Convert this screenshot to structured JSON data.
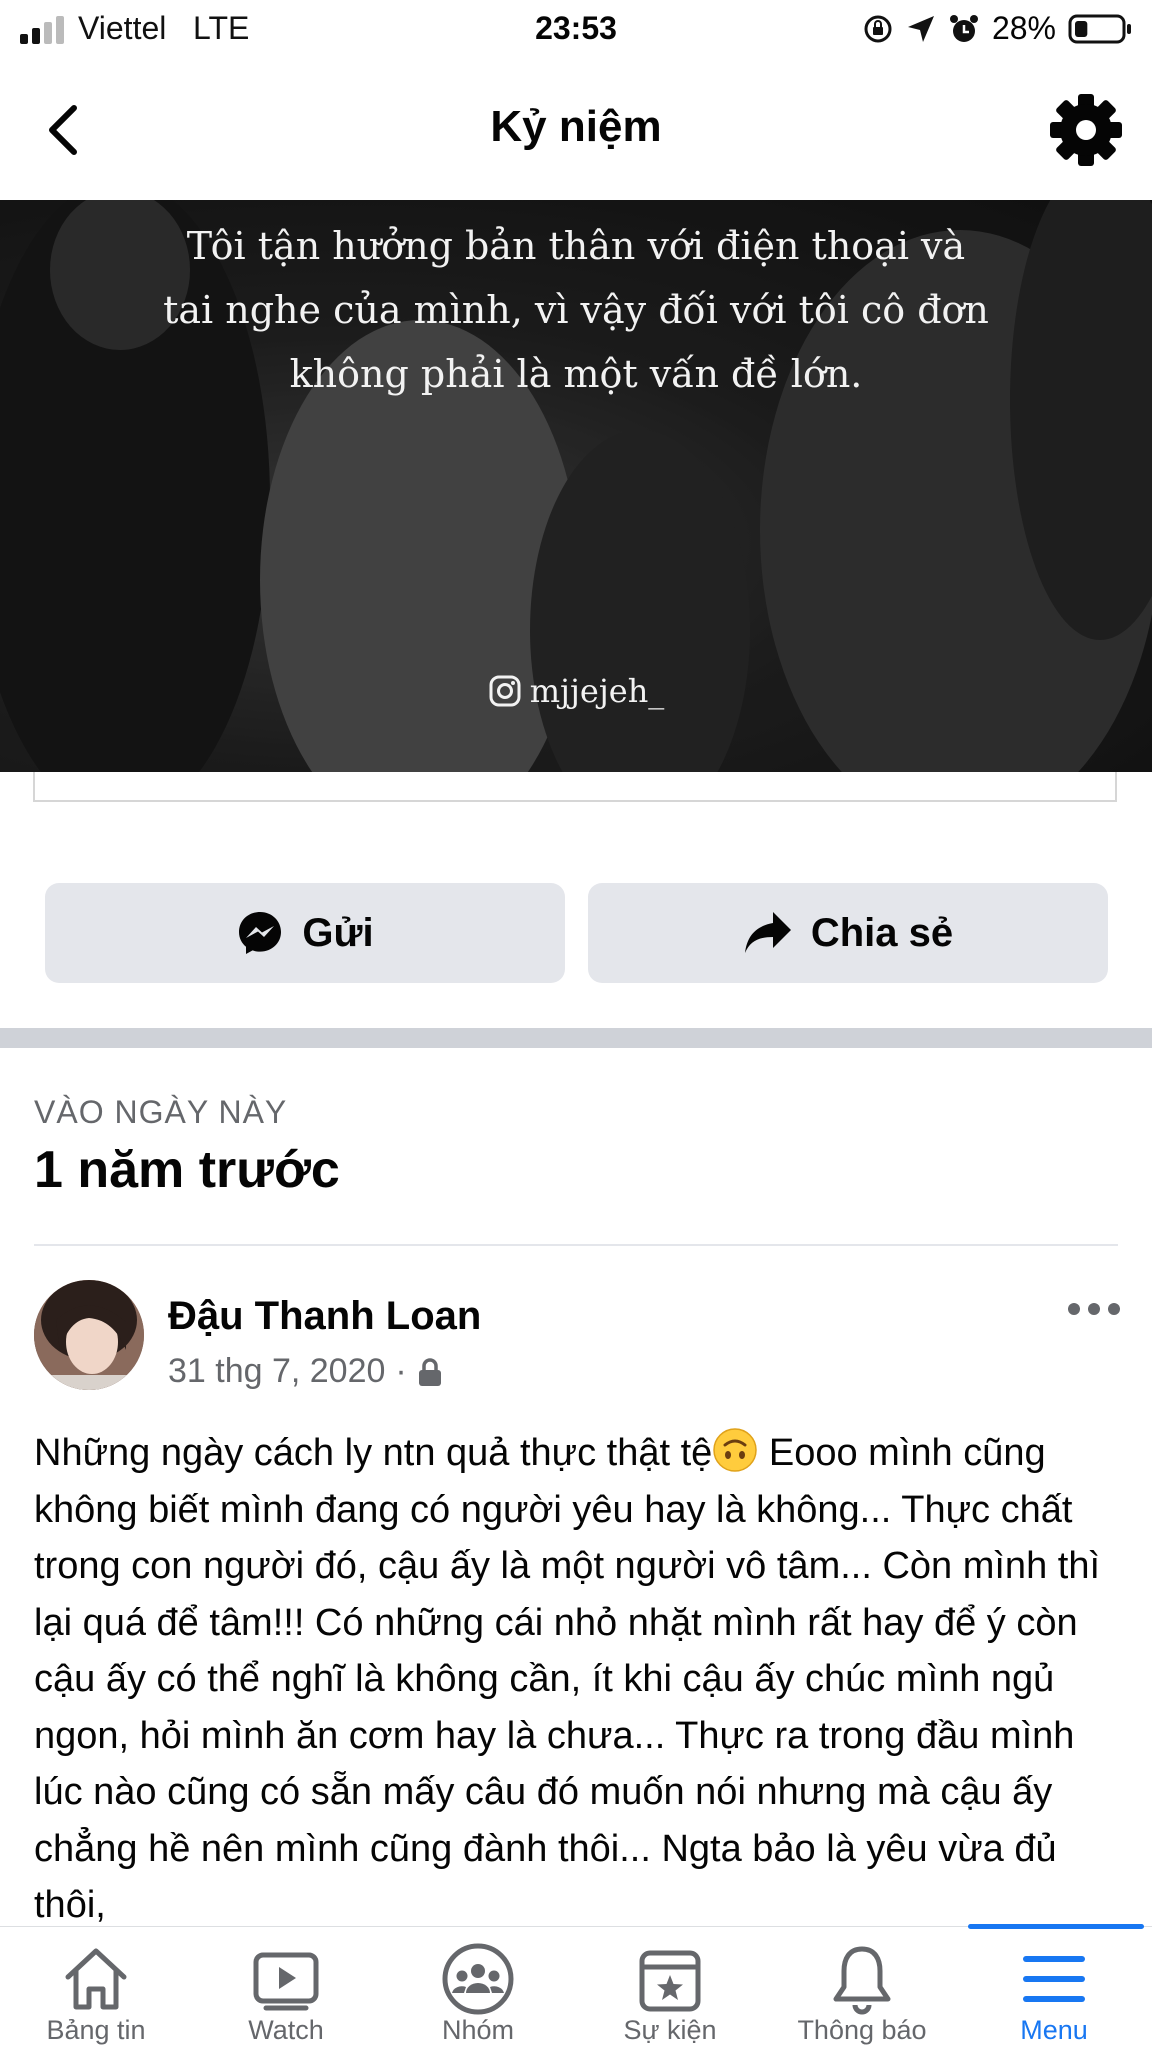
{
  "status_bar": {
    "carrier": "Viettel",
    "network": "LTE",
    "time": "23:53",
    "battery": "28%",
    "battery_level": 0.28
  },
  "header": {
    "title": "Kỷ niệm",
    "back_icon": "chevron-left-icon",
    "settings_icon": "gear-icon"
  },
  "memory": {
    "quote_lines": [
      "Tôi tận hưởng bản thân với điện thoại và",
      "tai nghe của mình, vì vậy đối với tôi cô đơn",
      "không phải là một vấn đề lớn."
    ],
    "instagram_handle": "mjjejeh_"
  },
  "actions": {
    "send_label": "Gửi",
    "share_label": "Chia sẻ"
  },
  "on_this_day": {
    "label": "VÀO NGÀY NÀY",
    "title": "1 năm trước"
  },
  "post": {
    "author": "Đậu Thanh Loan",
    "date": "31 thg 7, 2020",
    "separator": "·",
    "privacy_icon": "lock-icon",
    "body_before_emoji": "Những ngày cách ly ntn quả thực thật tệ",
    "body_after_emoji": " Eooo mình cũng không biết mình đang có người yêu hay là không... Thực chất trong con người đó, cậu ấy là một người vô tâm... Còn mình thì lại quá để tâm!!! Có những cái nhỏ nhặt mình rất hay để ý còn cậu ấy có thể nghĩ là không cần, ít khi cậu ấy chúc mình ngủ ngon, hỏi mình ăn cơm hay là chưa... Thực ra trong đầu mình lúc nào cũng có sẵn mấy câu đó muốn nói nhưng mà cậu ấy chẳng hề nên mình cũng đành thôi... Ngta bảo là yêu vừa đủ thôi,"
  },
  "tabs": [
    {
      "label": "Bảng tin",
      "icon": "home-icon",
      "active": false
    },
    {
      "label": "Watch",
      "icon": "watch-icon",
      "active": false
    },
    {
      "label": "Nhóm",
      "icon": "groups-icon",
      "active": false
    },
    {
      "label": "Sự kiện",
      "icon": "events-icon",
      "active": false
    },
    {
      "label": "Thông báo",
      "icon": "bell-icon",
      "active": false
    },
    {
      "label": "Menu",
      "icon": "menu-icon",
      "active": true
    }
  ],
  "colors": {
    "accent": "#1877f2",
    "button_bg": "#e4e6eb",
    "secondary_text": "#65676b"
  }
}
